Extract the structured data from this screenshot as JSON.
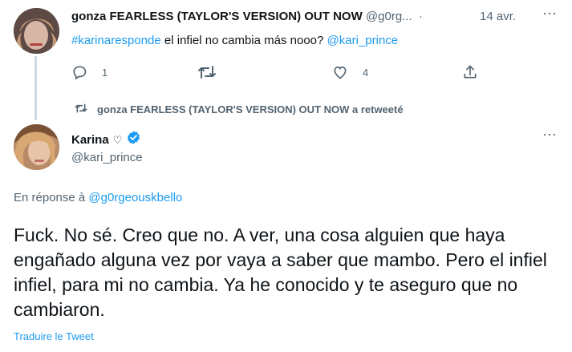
{
  "tweet1": {
    "display_name": "gonza FEARLESS (TAYLOR'S VERSION) OUT NOW",
    "handle": "@g0rg...",
    "separator": "·",
    "date": "14 avr.",
    "hashtag": "#karinaresponde",
    "text": " el infiel no cambia más nooo? ",
    "mention": "@kari_prince",
    "reply_count": "1",
    "like_count": "4",
    "icons": [
      "reply-icon",
      "retweet-icon",
      "like-icon",
      "share-icon",
      "more-icon"
    ]
  },
  "retweet_notice": {
    "text": "gonza FEARLESS (TAYLOR'S VERSION) OUT NOW a retweeté"
  },
  "tweet2": {
    "display_name": "Karina",
    "name_emoji": "♡",
    "handle": "@kari_prince",
    "reply_prefix": "En réponse à ",
    "reply_mention": "@g0rgeouskbello",
    "body": "Fuck. No sé. Creo que no. A ver, una cosa alguien que haya engañado alguna vez por vaya a saber que mambo. Pero el infiel infiel, para mi no cambia. Ya he conocido y te aseguro que no cambiaron.",
    "translate_label": "Traduire le Tweet"
  },
  "colors": {
    "accent": "#1d9bf0",
    "secondary_text": "#536471",
    "primary_text": "#0f1419"
  }
}
